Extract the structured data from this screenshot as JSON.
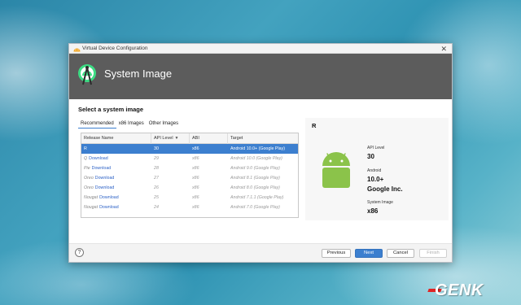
{
  "window": {
    "title": "Virtual Device Configuration",
    "close_glyph": "✕"
  },
  "header": {
    "title": "System Image"
  },
  "section_title": "Select a system image",
  "tabs": [
    {
      "label": "Recommended",
      "active": true
    },
    {
      "label": "x86 Images",
      "active": false
    },
    {
      "label": "Other Images",
      "active": false
    }
  ],
  "table": {
    "columns": [
      "Release Name",
      "API Level",
      "ABI",
      "Target"
    ],
    "sort_indicator": "▼",
    "rows": [
      {
        "release": "R",
        "download": "",
        "api": "30",
        "abi": "x86",
        "target": "Android 10.0+ (Google Play)",
        "selected": true
      },
      {
        "release": "Q",
        "download": "Download",
        "api": "29",
        "abi": "x86",
        "target": "Android 10.0 (Google Play)",
        "selected": false
      },
      {
        "release": "Pie",
        "download": "Download",
        "api": "28",
        "abi": "x86",
        "target": "Android 9.0 (Google Play)",
        "selected": false
      },
      {
        "release": "Oreo",
        "download": "Download",
        "api": "27",
        "abi": "x86",
        "target": "Android 8.1 (Google Play)",
        "selected": false
      },
      {
        "release": "Oreo",
        "download": "Download",
        "api": "26",
        "abi": "x86",
        "target": "Android 8.0 (Google Play)",
        "selected": false
      },
      {
        "release": "Nougat",
        "download": "Download",
        "api": "25",
        "abi": "x86",
        "target": "Android 7.1.1 (Google Play)",
        "selected": false
      },
      {
        "release": "Nougat",
        "download": "Download",
        "api": "24",
        "abi": "x86",
        "target": "Android 7.0 (Google Play)",
        "selected": false
      }
    ]
  },
  "detail": {
    "title": "R",
    "api_level_label": "API Level",
    "api_level_value": "30",
    "android_label": "Android",
    "android_version": "10.0+",
    "vendor": "Google Inc.",
    "system_image_label": "System Image",
    "system_image_value": "x86"
  },
  "footer": {
    "help_label": "?",
    "previous_label": "Previous",
    "next_label": "Next",
    "cancel_label": "Cancel",
    "finish_label": "Finish"
  },
  "watermark": {
    "text": "GENK"
  },
  "colors": {
    "header_bg": "#5c5c5c",
    "accent": "#3c7fcf",
    "android_green": "#8bc34a",
    "link": "#2e63c7"
  },
  "icons": {
    "window_icon": "android-studio-icon",
    "header_logo": "android-studio-logo-icon",
    "detail_image": "android-robot-icon"
  }
}
